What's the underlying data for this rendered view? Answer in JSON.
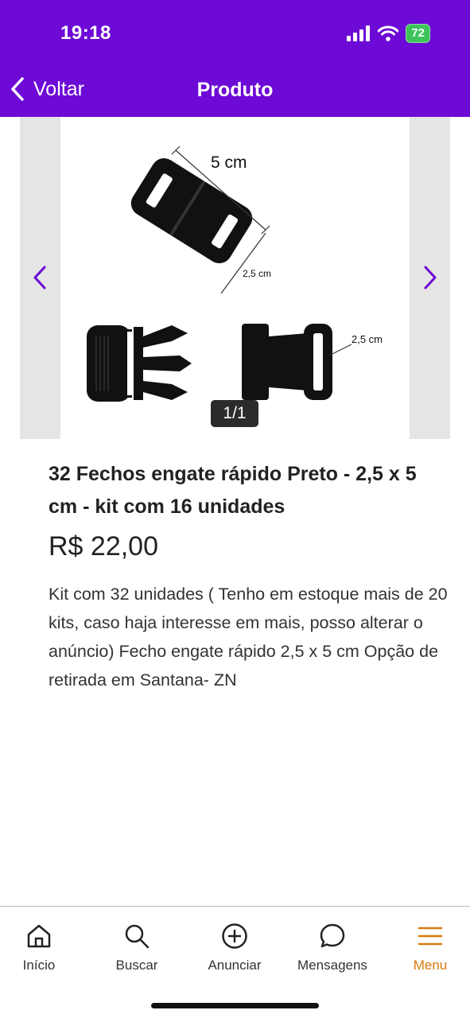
{
  "status": {
    "time": "19:18",
    "battery": "72"
  },
  "header": {
    "back_label": "Voltar",
    "title": "Produto"
  },
  "gallery": {
    "counter": "1/1",
    "image_labels": {
      "length": "5 cm",
      "width_top": "2,5 cm",
      "width_side": "2,5 cm"
    }
  },
  "product": {
    "title": "32 Fechos engate rápido Preto - 2,5 x 5 cm - kit com 16 unidades",
    "price": "R$ 22,00",
    "description": "Kit com 32 unidades ( Tenho em estoque mais de 20 kits, caso haja interesse em mais, posso alterar o anúncio) Fecho engate rápido 2,5 x 5 cm Opção de retirada em Santana- ZN"
  },
  "tabbar": {
    "items": [
      {
        "label": "Início",
        "icon": "home-icon"
      },
      {
        "label": "Buscar",
        "icon": "search-icon"
      },
      {
        "label": "Anunciar",
        "icon": "plus-circle-icon"
      },
      {
        "label": "Mensagens",
        "icon": "chat-bubble-icon"
      },
      {
        "label": "Menu",
        "icon": "hamburger-menu-icon"
      }
    ],
    "active_color": "#d87a0c"
  },
  "colors": {
    "brand": "#6d0ad6",
    "arrow": "#6d0ad6"
  }
}
